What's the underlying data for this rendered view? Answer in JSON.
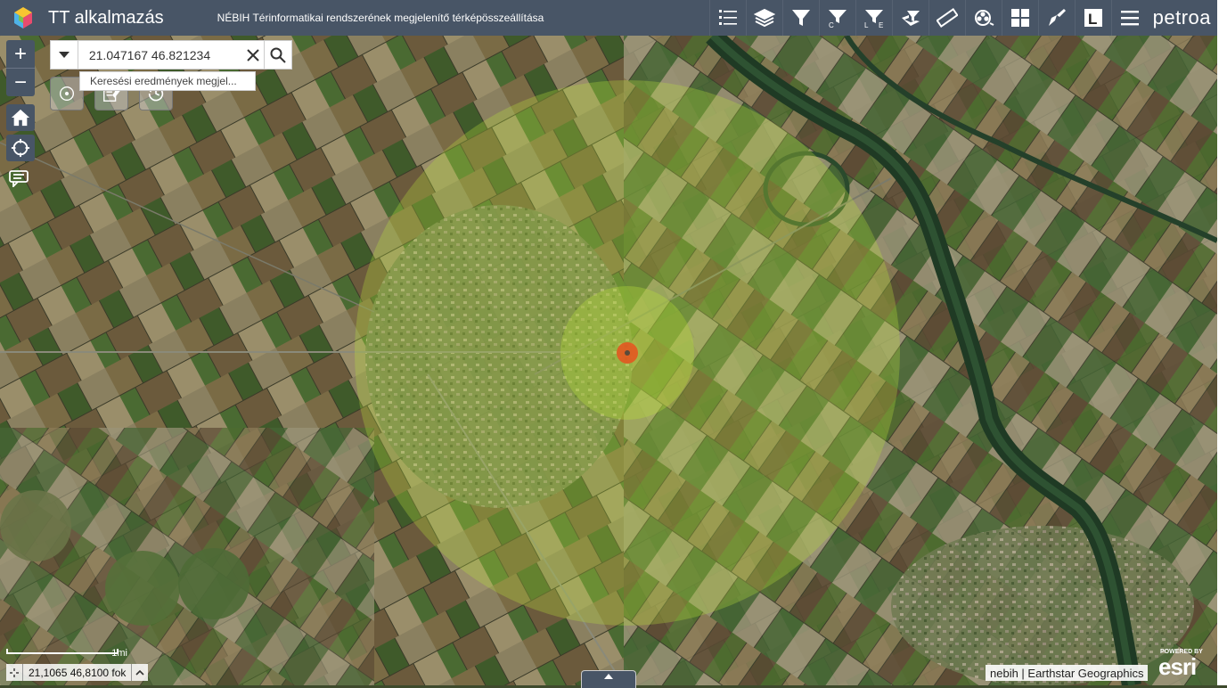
{
  "header": {
    "app_title": "TT alkalmazás",
    "subtitle": "NÉBIH Térinformatikai rendszerének megjelenítő térképösszeállítása",
    "brand": "petroa",
    "background": "#485566",
    "tools": [
      {
        "name": "legend-icon"
      },
      {
        "name": "layers-icon"
      },
      {
        "name": "filter-icon"
      },
      {
        "name": "filter-c-icon"
      },
      {
        "name": "filter-le-icon"
      },
      {
        "name": "layer-filter-icon"
      },
      {
        "name": "measure-icon"
      },
      {
        "name": "film-icon"
      },
      {
        "name": "grid-icon"
      },
      {
        "name": "draw-icon"
      },
      {
        "name": "l-icon"
      },
      {
        "name": "menu-icon"
      }
    ]
  },
  "search": {
    "value": "21.047167 46.821234",
    "suggestion": "Keresési eredmények megjel..."
  },
  "map": {
    "marker_color": "#e8521e",
    "buffer_color": "#a8d43a",
    "scale_label": "1mi",
    "coordinates": "21,1065 46,8100 fok",
    "attribution": "nebih | Earthstar Geographics",
    "esri_powered": "POWERED BY",
    "esri": "esri"
  }
}
